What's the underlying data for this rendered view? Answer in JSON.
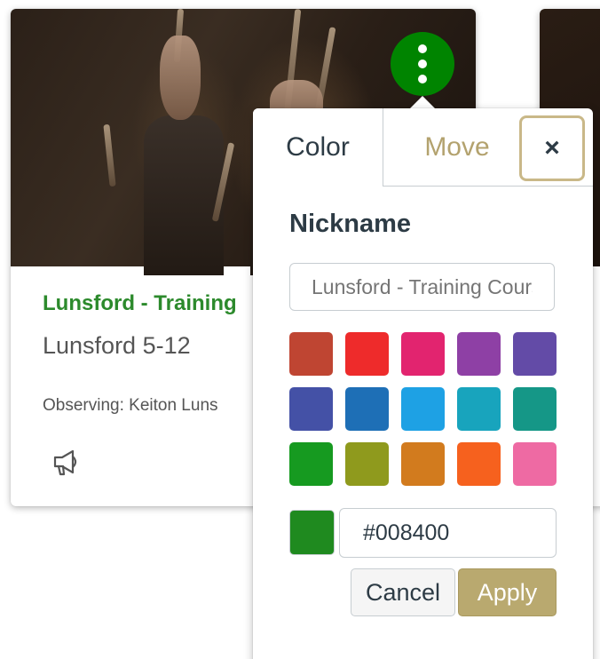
{
  "card": {
    "title": "Lunsford - Training",
    "subtitle": "Lunsford 5-12",
    "term": "Observing: Keiton Luns",
    "announcement_icon": "megaphone-icon"
  },
  "options_button": {
    "icon": "kebab-vertical-icon",
    "color": "#008400"
  },
  "popover": {
    "tabs": [
      {
        "label": "Color",
        "active": true
      },
      {
        "label": "Move",
        "active": false
      }
    ],
    "close_label": "×",
    "nickname_label": "Nickname",
    "nickname_placeholder": "Lunsford - Training Course",
    "swatches": [
      "#bf4532",
      "#ee2b2b",
      "#e2246f",
      "#8e40a5",
      "#634ba7",
      "#4451a6",
      "#1e6fb6",
      "#1ea1e4",
      "#18a4bd",
      "#159787",
      "#169a20",
      "#8f9a1d",
      "#d27b1e",
      "#f6611e",
      "#ee6aa3"
    ],
    "selected_color": "#1f8a1f",
    "hex_value": "#008400",
    "cancel_label": "Cancel",
    "apply_label": "Apply"
  }
}
